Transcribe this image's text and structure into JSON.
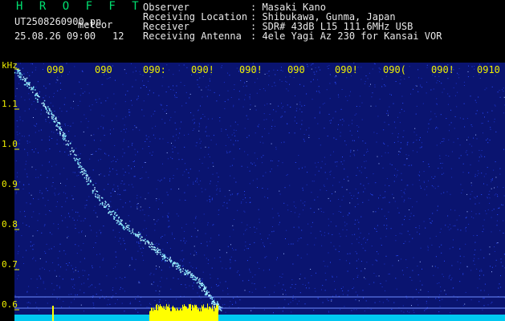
{
  "header": {
    "app_title": "H R O F F T",
    "filename": "UT2508260900.pn",
    "tag": "meteor",
    "datetime": "25.08.26 09:00",
    "count": "12",
    "info": [
      {
        "label": "Observer",
        "value": ": Masaki Kano"
      },
      {
        "label": "Receiving Location",
        "value": ": Shibukawa, Gunma, Japan"
      },
      {
        "label": "Receiver",
        "value": ": SDR# 43dB L15 111.6MHz USB"
      },
      {
        "label": "Receiving Antenna",
        "value": ": 4ele Yagi Az 230 for Kansai VOR"
      }
    ]
  },
  "spectrogram": {
    "y_unit": "kHz",
    "y_ticks": [
      "1.1",
      "1.0",
      "0.9",
      "0.8",
      "0.7",
      "0.6"
    ],
    "x_ticks": [
      "090",
      "090",
      "090:",
      "090!",
      "090!",
      "090",
      "090!",
      "090(",
      "090!",
      "0910"
    ],
    "colors": {
      "background": "#0a1470",
      "noise": "#2a4cff",
      "trace": "#7fe8ff",
      "baseline": "#00d8ff",
      "burst": "#ffff00",
      "axis": "#f0f000"
    }
  }
}
